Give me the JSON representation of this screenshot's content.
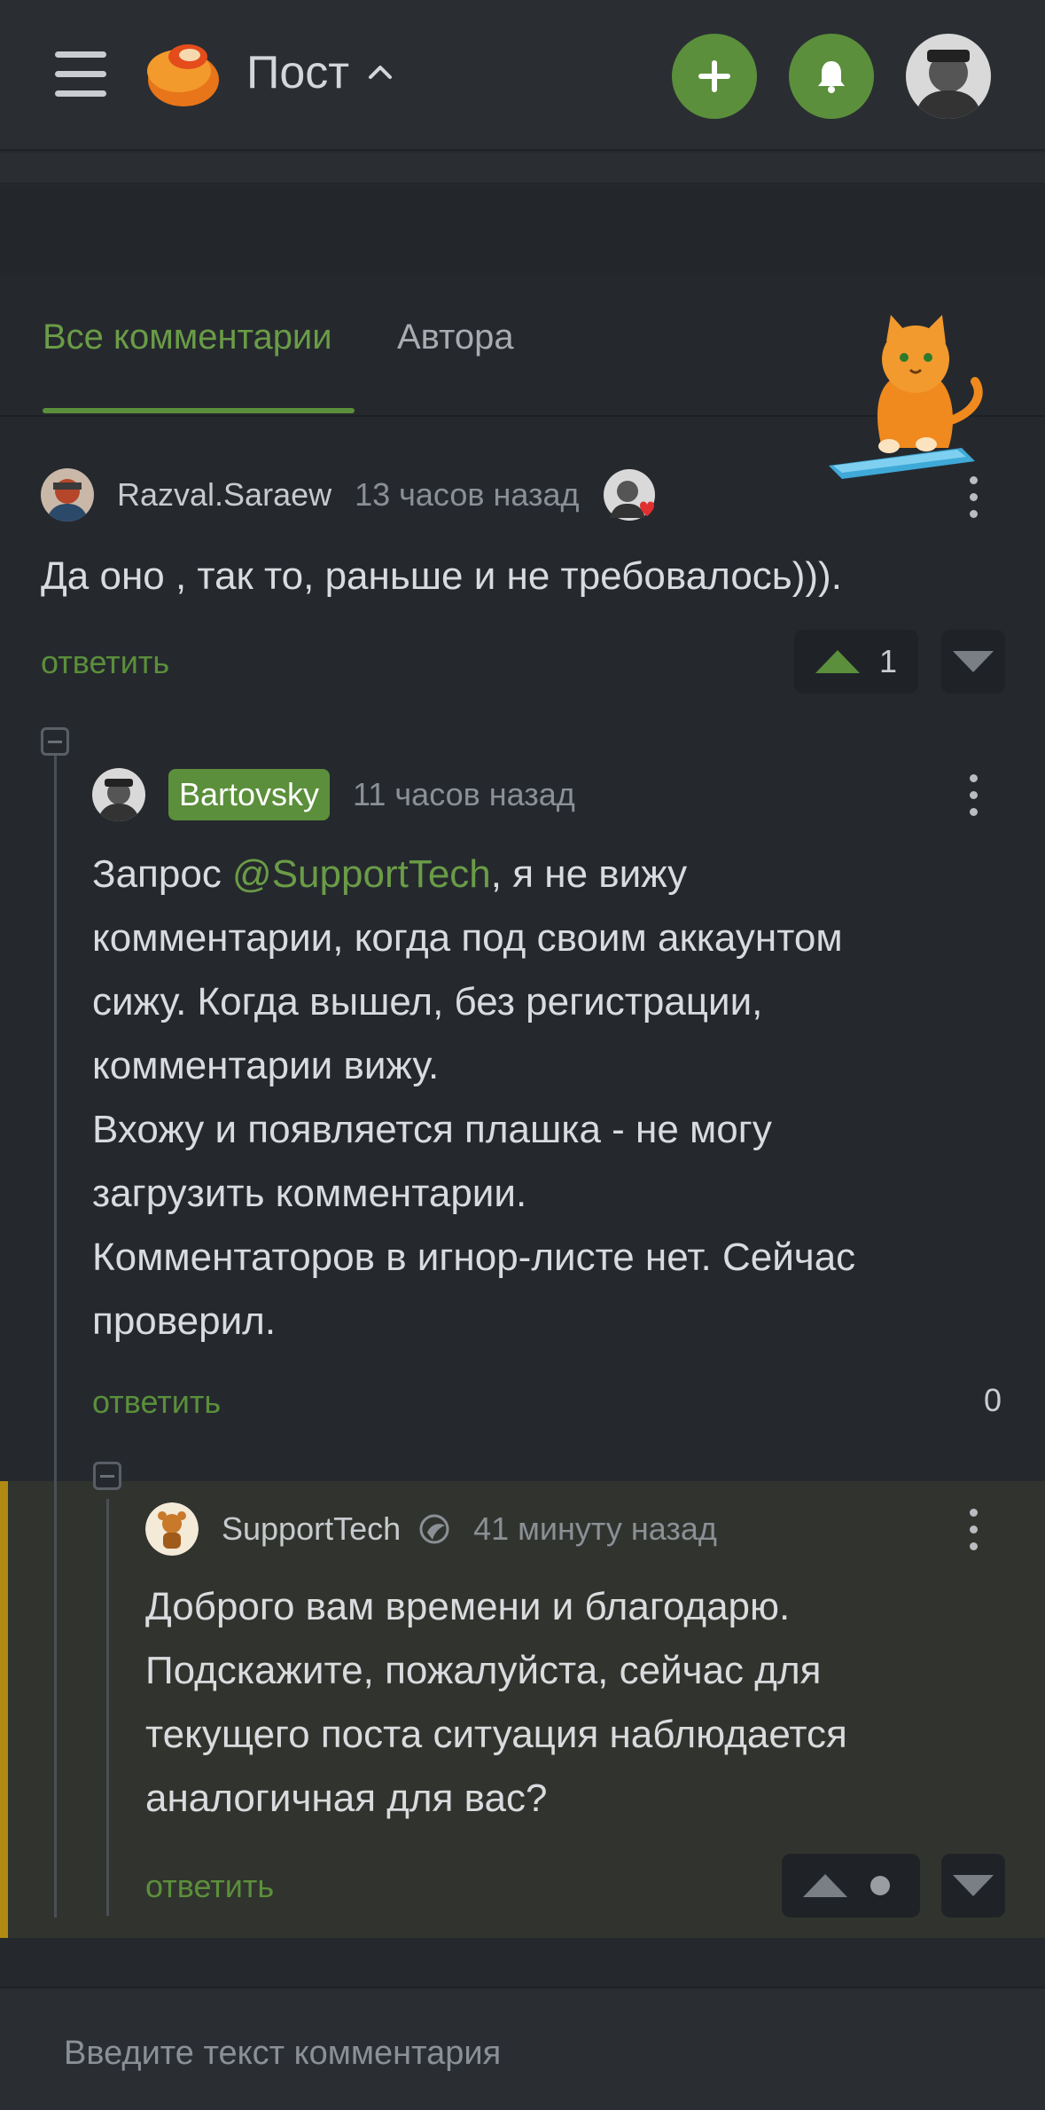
{
  "header": {
    "title": "Пост"
  },
  "tabs": [
    {
      "label": "Все комментарии",
      "active": true
    },
    {
      "label": "Автора",
      "active": false
    }
  ],
  "comments": [
    {
      "username": "Razval.Saraew",
      "time": "13 часов назад",
      "text": "Да оно , так то, раньше и не требовалось))).",
      "reply_label": "ответить",
      "rating": "1"
    },
    {
      "username": "Bartovsky",
      "time": "11 часов назад",
      "text_before_mention": "Запрос ",
      "mention": "@SupportTech",
      "text_line1_rest": ", я не вижу",
      "lines": [
        "комментарии, когда под своим аккаунтом",
        "сижу. Когда вышел, без регистрации,",
        "комментарии вижу.",
        "Вхожу и появляется плашка - не могу",
        "загрузить комментарии.",
        "Комментаторов в игнор-листе нет. Сейчас",
        "проверил."
      ],
      "reply_label": "ответить",
      "rating": "0"
    },
    {
      "username": "SupportTech",
      "time": "41 минуту назад",
      "lines": [
        "Доброго вам времени и благодарю.",
        "Подскажите, пожалуйста, сейчас для",
        "текущего поста ситуация наблюдается",
        "аналогичная для вас?"
      ],
      "reply_label": "ответить"
    }
  ],
  "comment_input": {
    "placeholder": "Введите текст комментария"
  },
  "colors": {
    "accent": "#5b8f3b",
    "background": "#25292e",
    "highlight_bar": "#b08a12"
  },
  "icons": [
    "menu-icon",
    "logo-icon",
    "chevron-up-icon",
    "plus-icon",
    "bell-icon",
    "kebab-icon",
    "upvote-icon",
    "downvote-icon",
    "collapse-icon"
  ]
}
